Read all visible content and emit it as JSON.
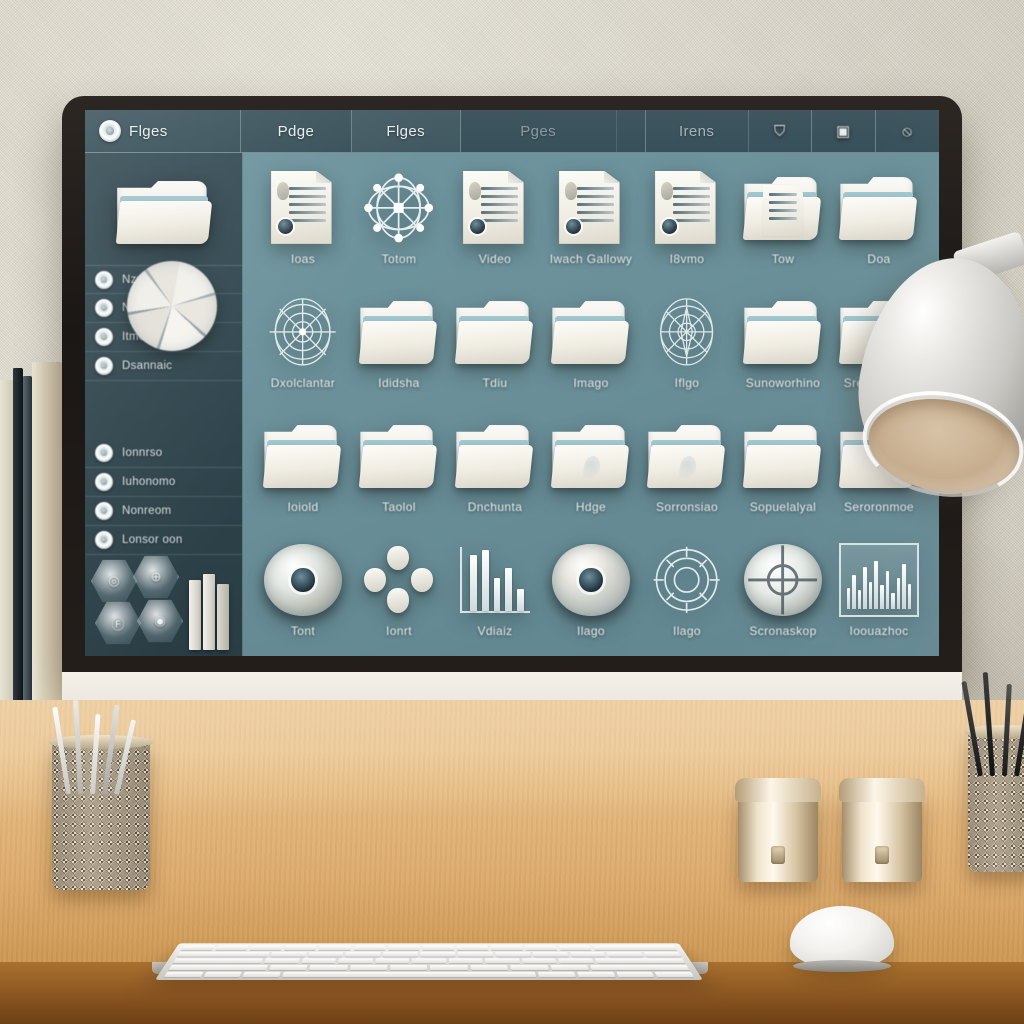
{
  "app": {
    "title": "Flges",
    "brand_icon": "circle-target-icon"
  },
  "toolbar": {
    "tabs": [
      {
        "label": "Pdge",
        "icon": "tab-icon"
      },
      {
        "label": "Flges",
        "icon": "tab-icon"
      },
      {
        "label": "Pges",
        "icon": "tab-icon"
      }
    ],
    "right_label": "Irens",
    "icons": [
      {
        "name": "shield-badge-icon",
        "glyph": "⛉"
      },
      {
        "name": "rounded-square-icon",
        "glyph": "▣"
      },
      {
        "name": "oval-link-icon",
        "glyph": "⦸"
      }
    ]
  },
  "sidebar": {
    "header_icon": "open-folder-icon",
    "items": [
      {
        "label": "Nzunae",
        "icon": "quick-access-icon"
      },
      {
        "label": "Nemst Gaov",
        "icon": "recent-icon"
      },
      {
        "label": "Itmonano",
        "icon": "documents-icon"
      },
      {
        "label": "Dsannaic",
        "icon": "downloads-icon"
      },
      {
        "label": "Ionnrso",
        "icon": "pictures-icon"
      },
      {
        "label": "Iuhonomo",
        "icon": "music-icon"
      },
      {
        "label": "Nonreom",
        "icon": "videos-icon"
      },
      {
        "label": "Lonsor oon",
        "icon": "network-icon"
      }
    ],
    "chart": {
      "name": "pie-chart-overlay",
      "slices": 6
    },
    "badges": [
      {
        "label": "◎",
        "name": "hex-badge-1"
      },
      {
        "label": "⊕",
        "name": "hex-badge-2"
      },
      {
        "label": "Ⓕ",
        "name": "hex-badge-3"
      },
      {
        "label": "◉",
        "name": "hex-badge-4"
      }
    ]
  },
  "grid": {
    "rows": [
      [
        {
          "label": "Ioas",
          "type": "document"
        },
        {
          "label": "Totom",
          "type": "network"
        },
        {
          "label": "Video",
          "type": "document"
        },
        {
          "label": "Iwach Gallowy",
          "type": "document"
        },
        {
          "label": "I8vmo",
          "type": "document"
        },
        {
          "label": "Tow",
          "type": "folder-doc"
        },
        {
          "label": "Doa",
          "type": "folder"
        }
      ],
      [
        {
          "label": "Dxolclantar",
          "type": "compass"
        },
        {
          "label": "Ididsha",
          "type": "folder"
        },
        {
          "label": "Tdiu",
          "type": "folder"
        },
        {
          "label": "Imago",
          "type": "folder"
        },
        {
          "label": "Iflgo",
          "type": "compass"
        },
        {
          "label": "Sunoworhino",
          "type": "folder"
        },
        {
          "label": "Srerenshrun",
          "type": "folder"
        }
      ],
      [
        {
          "label": "Ioiold",
          "type": "folder"
        },
        {
          "label": "Taolol",
          "type": "folder"
        },
        {
          "label": "Dnchunta",
          "type": "folder"
        },
        {
          "label": "Hdge",
          "type": "folder-emblem"
        },
        {
          "label": "Sorronsiao",
          "type": "folder-emblem"
        },
        {
          "label": "Sopuelalyal",
          "type": "folder"
        },
        {
          "label": "Seroronmoe",
          "type": "folder"
        }
      ],
      [
        {
          "label": "Tont",
          "type": "emblem"
        },
        {
          "label": "Ionrt",
          "type": "petals"
        },
        {
          "label": "Vdiaiz",
          "type": "barchart"
        },
        {
          "label": "Ilago",
          "type": "eye"
        },
        {
          "label": "Ilago",
          "type": "compass-dark"
        },
        {
          "label": "Scronaskop",
          "type": "target"
        },
        {
          "label": "Ioouazhoc",
          "type": "chart-image"
        }
      ]
    ]
  },
  "desk": {
    "items": [
      {
        "name": "pen-cup-left"
      },
      {
        "name": "pen-cup-right"
      },
      {
        "name": "canister-left"
      },
      {
        "name": "canister-right"
      },
      {
        "name": "keyboard"
      },
      {
        "name": "mouse"
      },
      {
        "name": "desk-lamp"
      },
      {
        "name": "book-stack"
      }
    ]
  },
  "colors": {
    "screen_bg": "#6b9099",
    "toolbar_bg": "#3b5058",
    "sidebar_bg": "#2f444c",
    "bezel": "#1f1a17",
    "desk": "#dcab6e",
    "wall": "#ded9ca"
  }
}
